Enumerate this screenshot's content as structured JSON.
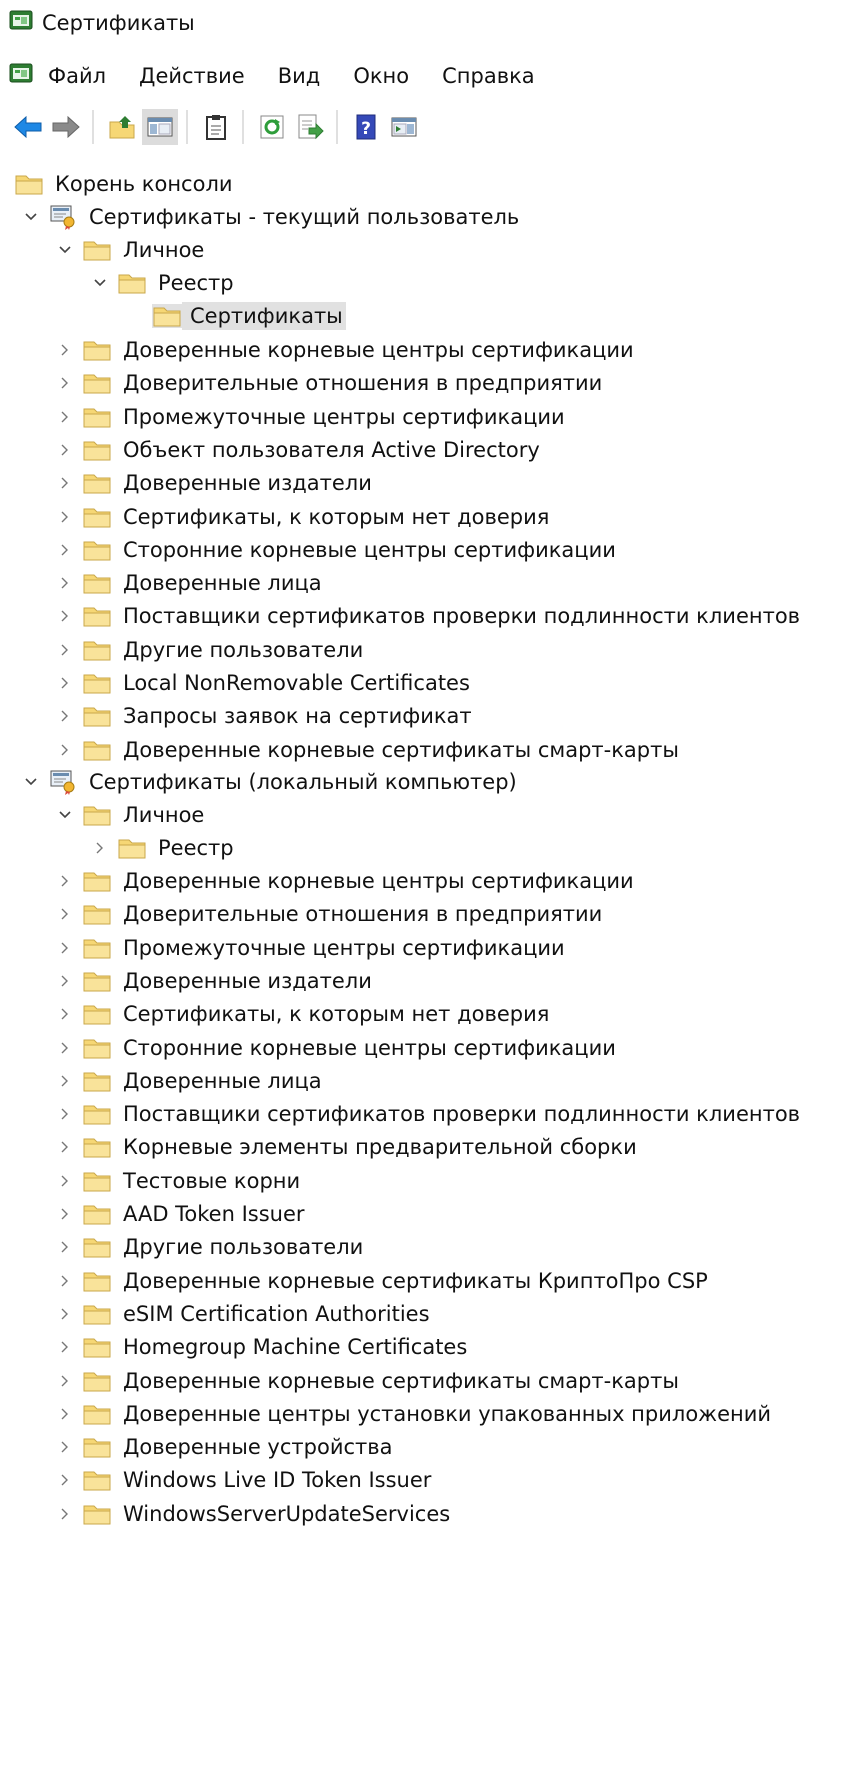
{
  "window": {
    "title": "Сертификаты",
    "app_icon": "mmc-console-icon"
  },
  "menu": {
    "items": [
      "Файл",
      "Действие",
      "Вид",
      "Окно",
      "Справка"
    ]
  },
  "toolbar": {
    "buttons": [
      "back-arrow-icon",
      "forward-arrow-icon",
      "up-folder-icon",
      "show-hide-tree-icon",
      "clipboard-icon",
      "refresh-icon",
      "export-list-icon",
      "help-icon",
      "action-pane-icon"
    ]
  },
  "colors": {
    "folder_fill": "#f6d775",
    "folder_stroke": "#c9a74a",
    "selection_bg": "#e1e1e1",
    "back_arrow": "#1e88e5",
    "forward_arrow": "#8a8a8a"
  },
  "tree": {
    "root": "Корень консоли",
    "user": {
      "label": "Сертификаты - текущий пользователь",
      "personal": "Личное",
      "registry": "Реестр",
      "certificates": "Сертификаты",
      "children": [
        "Доверенные корневые центры сертификации",
        "Доверительные отношения в предприятии",
        "Промежуточные центры сертификации",
        "Объект пользователя Active Directory",
        "Доверенные издатели",
        "Сертификаты, к которым нет доверия",
        "Сторонние корневые центры сертификации",
        "Доверенные лица",
        "Поставщики сертификатов проверки подлинности клиентов",
        "Другие пользователи",
        "Local NonRemovable Certificates",
        "Запросы заявок на сертификат",
        "Доверенные корневые сертификаты смарт-карты"
      ]
    },
    "machine": {
      "label": "Сертификаты (локальный компьютер)",
      "personal": "Личное",
      "registry": "Реестр",
      "children": [
        "Доверенные корневые центры сертификации",
        "Доверительные отношения в предприятии",
        "Промежуточные центры сертификации",
        "Доверенные издатели",
        "Сертификаты, к которым нет доверия",
        "Сторонние корневые центры сертификации",
        "Доверенные лица",
        "Поставщики сертификатов проверки подлинности клиентов",
        "Корневые элементы предварительной сборки",
        "Тестовые корни",
        "AAD Token Issuer",
        "Другие пользователи",
        "Доверенные корневые сертификаты КриптоПро CSP",
        "eSIM Certification Authorities",
        "Homegroup Machine Certificates",
        "Доверенные корневые сертификаты смарт-карты",
        "Доверенные центры установки упакованных приложений",
        "Доверенные устройства",
        "Windows Live ID Token Issuer",
        "WindowsServerUpdateServices"
      ]
    }
  }
}
